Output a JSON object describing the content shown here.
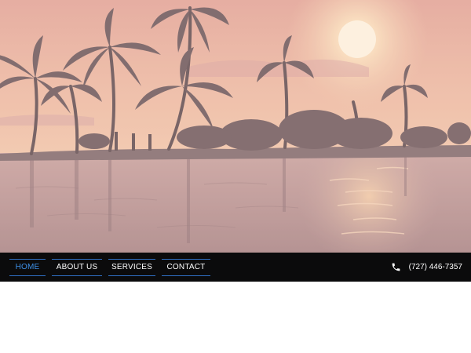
{
  "hero": {
    "image": "sunset-palm-trees-backwaters",
    "colors": {
      "sky_top": "#e6a99a",
      "sky_mid": "#efc0a6",
      "sun": "#fff6d8",
      "water": "#b89594",
      "trees": "#6f5b5e"
    }
  },
  "nav": {
    "items": [
      {
        "label": "HOME",
        "active": true
      },
      {
        "label": "ABOUT US",
        "active": false
      },
      {
        "label": "SERVICES",
        "active": false
      },
      {
        "label": "CONTACT",
        "active": false
      }
    ],
    "accent_color": "#3d8fe6",
    "border_color": "#2f6fc4"
  },
  "contact": {
    "phone": "(727) 446-7357",
    "icon": "phone-icon"
  }
}
